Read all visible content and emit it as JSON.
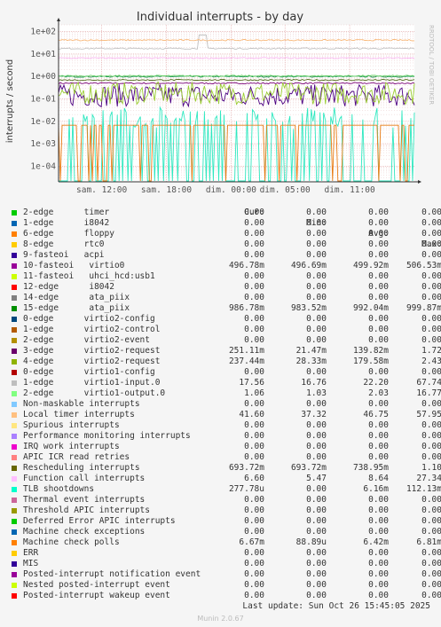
{
  "chart_data": {
    "type": "line",
    "title": "Individual interrupts - by day",
    "ylabel": "interrupts / second",
    "side_label": "RRDTOOL / TOBI OETIKER",
    "yscale": "log",
    "ylim": [
      2e-05,
      200
    ],
    "y_ticks": [
      "1e+02",
      "1e+01",
      "1e+00",
      "1e-01",
      "1e-02",
      "1e-03",
      "1e-04"
    ],
    "y_tick_values": [
      100,
      10,
      1,
      0.1,
      0.01,
      0.001,
      0.0001
    ],
    "x_ticks": [
      "sam. 12:00",
      "sam. 18:00",
      "dim. 00:00",
      "dim. 05:00",
      "dim. 11:00"
    ],
    "x_tick_hours": [
      4,
      10,
      16,
      21,
      27
    ],
    "x_range_hours": [
      0,
      33
    ],
    "series": [
      {
        "name": "virtio0",
        "color": "#7a0177",
        "level": 0.497
      },
      {
        "name": "ata_piix (15-edge)",
        "color": "#1a9850",
        "level": 0.987
      },
      {
        "name": "virtio2-request (3-edge)",
        "color": "#4b0082",
        "level": 0.14
      },
      {
        "name": "virtio2-request (4-edge)",
        "color": "#9acd32",
        "level": 0.18
      },
      {
        "name": "virtio1-input.0",
        "color": "#c0c0c0",
        "level": 17.6
      },
      {
        "name": "virtio1-output.0",
        "color": "#6ad36a",
        "level": 1.06
      },
      {
        "name": "Local timer interrupts",
        "color": "#f8b878",
        "level": 41.6
      },
      {
        "name": "Rescheduling interrupts",
        "color": "#4f6b1a",
        "level": 0.694
      },
      {
        "name": "Function call interrupts",
        "color": "#f9b8f2",
        "level": 6.6
      },
      {
        "name": "TLB shootdowns",
        "color": "#2fe8c0",
        "level": 0.000278
      },
      {
        "name": "Machine check polls",
        "color": "#e87c14",
        "level": 0.00667
      }
    ]
  },
  "legend": {
    "headers": {
      "cur": "Cur:",
      "min": "Min:",
      "avg": "Avg:",
      "max": "Max:"
    },
    "rows": [
      {
        "label": "2-edge      timer",
        "color": "#00cc00",
        "cur": "0.00",
        "min": "0.00",
        "avg": "0.00",
        "max": "0.00"
      },
      {
        "label": "1-edge      i8042",
        "color": "#0066b3",
        "cur": "0.00",
        "min": "0.00",
        "avg": "0.00",
        "max": "0.00"
      },
      {
        "label": "6-edge      floppy",
        "color": "#ff8000",
        "cur": "0.00",
        "min": "0.00",
        "avg": "0.00",
        "max": "0.00"
      },
      {
        "label": "8-edge      rtc0",
        "color": "#ffcc00",
        "cur": "0.00",
        "min": "0.00",
        "avg": "0.00",
        "max": "0.00"
      },
      {
        "label": "9-fasteoi   acpi",
        "color": "#330099",
        "cur": "0.00",
        "min": "0.00",
        "avg": "0.00",
        "max": "0.00"
      },
      {
        "label": "10-fasteoi   virtio0",
        "color": "#990099",
        "cur": "496.78m",
        "min": "496.69m",
        "avg": "499.92m",
        "max": "506.53m"
      },
      {
        "label": "11-fasteoi   uhci_hcd:usb1",
        "color": "#ccff00",
        "cur": "0.00",
        "min": "0.00",
        "avg": "0.00",
        "max": "0.00"
      },
      {
        "label": "12-edge      i8042",
        "color": "#ff0000",
        "cur": "0.00",
        "min": "0.00",
        "avg": "0.00",
        "max": "0.00"
      },
      {
        "label": "14-edge      ata_piix",
        "color": "#808080",
        "cur": "0.00",
        "min": "0.00",
        "avg": "0.00",
        "max": "0.00"
      },
      {
        "label": "15-edge      ata_piix",
        "color": "#008f00",
        "cur": "986.78m",
        "min": "983.52m",
        "avg": "992.04m",
        "max": "999.87m"
      },
      {
        "label": "0-edge      virtio2-config",
        "color": "#00487d",
        "cur": "0.00",
        "min": "0.00",
        "avg": "0.00",
        "max": "0.00"
      },
      {
        "label": "1-edge      virtio2-control",
        "color": "#b35a00",
        "cur": "0.00",
        "min": "0.00",
        "avg": "0.00",
        "max": "0.00"
      },
      {
        "label": "2-edge      virtio2-event",
        "color": "#b38f00",
        "cur": "0.00",
        "min": "0.00",
        "avg": "0.00",
        "max": "0.00"
      },
      {
        "label": "3-edge      virtio2-request",
        "color": "#6b006b",
        "cur": "251.11m",
        "min": "21.47m",
        "avg": "139.82m",
        "max": "1.72"
      },
      {
        "label": "4-edge      virtio2-request",
        "color": "#8fb300",
        "cur": "237.44m",
        "min": "28.33m",
        "avg": "179.58m",
        "max": "2.43"
      },
      {
        "label": "0-edge      virtio1-config",
        "color": "#b30000",
        "cur": "0.00",
        "min": "0.00",
        "avg": "0.00",
        "max": "0.00"
      },
      {
        "label": "1-edge      virtio1-input.0",
        "color": "#bebebe",
        "cur": "17.56",
        "min": "16.76",
        "avg": "22.20",
        "max": "67.74"
      },
      {
        "label": "2-edge      virtio1-output.0",
        "color": "#80ff80",
        "cur": "1.06",
        "min": "1.03",
        "avg": "2.03",
        "max": "16.77"
      },
      {
        "label": "Non-maskable interrupts",
        "color": "#80c9ff",
        "cur": "0.00",
        "min": "0.00",
        "avg": "0.00",
        "max": "0.00"
      },
      {
        "label": "Local timer interrupts",
        "color": "#ffc080",
        "cur": "41.60",
        "min": "37.32",
        "avg": "46.75",
        "max": "57.95"
      },
      {
        "label": "Spurious interrupts",
        "color": "#ffe680",
        "cur": "0.00",
        "min": "0.00",
        "avg": "0.00",
        "max": "0.00"
      },
      {
        "label": "Performance monitoring interrupts",
        "color": "#aa80ff",
        "cur": "0.00",
        "min": "0.00",
        "avg": "0.00",
        "max": "0.00"
      },
      {
        "label": "IRQ work interrupts",
        "color": "#ee00cc",
        "cur": "0.00",
        "min": "0.00",
        "avg": "0.00",
        "max": "0.00"
      },
      {
        "label": "APIC ICR read retries",
        "color": "#ff8080",
        "cur": "0.00",
        "min": "0.00",
        "avg": "0.00",
        "max": "0.00"
      },
      {
        "label": "Rescheduling interrupts",
        "color": "#666600",
        "cur": "693.72m",
        "min": "693.72m",
        "avg": "738.95m",
        "max": "1.10"
      },
      {
        "label": "Function call interrupts",
        "color": "#ffbfff",
        "cur": "6.60",
        "min": "5.47",
        "avg": "8.64",
        "max": "27.34"
      },
      {
        "label": "TLB shootdowns",
        "color": "#00ffcc",
        "cur": "277.78u",
        "min": "0.00",
        "avg": "6.16m",
        "max": "112.13m"
      },
      {
        "label": "Thermal event interrupts",
        "color": "#cc6699",
        "cur": "0.00",
        "min": "0.00",
        "avg": "0.00",
        "max": "0.00"
      },
      {
        "label": "Threshold APIC interrupts",
        "color": "#999900",
        "cur": "0.00",
        "min": "0.00",
        "avg": "0.00",
        "max": "0.00"
      },
      {
        "label": "Deferred Error APIC interrupts",
        "color": "#00cc00",
        "cur": "0.00",
        "min": "0.00",
        "avg": "0.00",
        "max": "0.00"
      },
      {
        "label": "Machine check exceptions",
        "color": "#0066b3",
        "cur": "0.00",
        "min": "0.00",
        "avg": "0.00",
        "max": "0.00"
      },
      {
        "label": "Machine check polls",
        "color": "#ff8000",
        "cur": "6.67m",
        "min": "88.89u",
        "avg": "6.42m",
        "max": "6.81m"
      },
      {
        "label": "ERR",
        "color": "#ffcc00",
        "cur": "0.00",
        "min": "0.00",
        "avg": "0.00",
        "max": "0.00"
      },
      {
        "label": "MIS",
        "color": "#330099",
        "cur": "0.00",
        "min": "0.00",
        "avg": "0.00",
        "max": "0.00"
      },
      {
        "label": "Posted-interrupt notification event",
        "color": "#990099",
        "cur": "0.00",
        "min": "0.00",
        "avg": "0.00",
        "max": "0.00"
      },
      {
        "label": "Nested posted-interrupt event",
        "color": "#ccff00",
        "cur": "0.00",
        "min": "0.00",
        "avg": "0.00",
        "max": "0.00"
      },
      {
        "label": "Posted-interrupt wakeup event",
        "color": "#ff0000",
        "cur": "0.00",
        "min": "0.00",
        "avg": "0.00",
        "max": "0.00"
      }
    ]
  },
  "footer": {
    "last_update": "Last update: Sun Oct 26 15:45:05 2025",
    "munin_version": "Munin 2.0.67"
  }
}
